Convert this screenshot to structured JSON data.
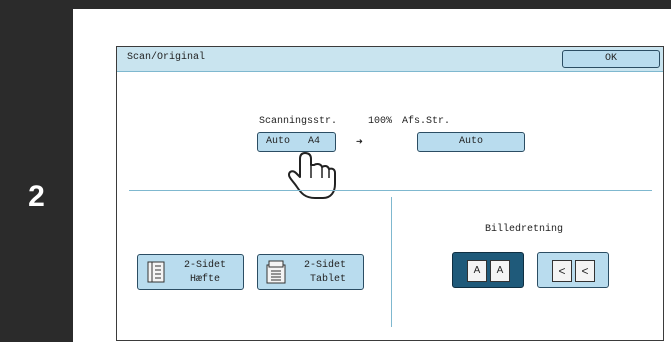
{
  "step": {
    "number": "2"
  },
  "dialog": {
    "title": "Scan/Original",
    "ok_label": "OK"
  },
  "scan": {
    "scan_size_label": "Scanningsstr.",
    "ratio": "100%",
    "send_size_label": "Afs.Str.",
    "scan_mode": "Auto",
    "scan_size": "A4",
    "arrow": "➜",
    "send_size": "Auto"
  },
  "duplex": {
    "booklet_line1": "2-Sidet",
    "booklet_line2": "Hæfte",
    "tablet_line1": "2-Sidet",
    "tablet_line2": "Tablet"
  },
  "orientation": {
    "label": "Billedretning",
    "glyph_a": "A",
    "glyph_rot": "<",
    "selected": "upright"
  },
  "colors": {
    "accent": "#b9dcee",
    "selected": "#1f5a7a",
    "titlebar": "#c9e4ef"
  }
}
